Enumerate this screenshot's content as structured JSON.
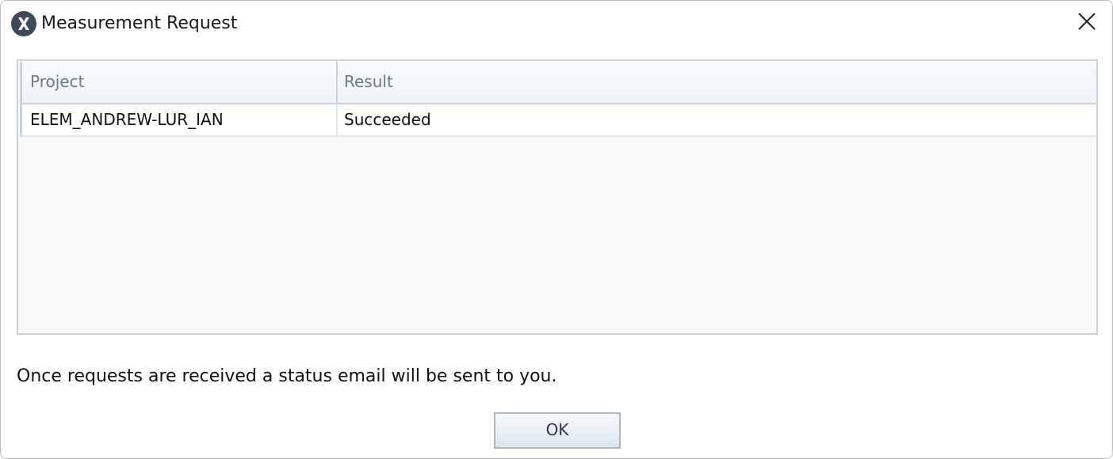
{
  "window": {
    "title": "Measurement Request",
    "app_icon": "x-circle-logo-icon",
    "close_icon": "close-icon"
  },
  "table": {
    "columns": [
      "Project",
      "Result"
    ],
    "rows": [
      [
        "ELEM_ANDREW-LUR_IAN",
        "Succeeded"
      ]
    ]
  },
  "message": "Once requests are received a status email will be sent to you.",
  "buttons": {
    "ok_label": "OK"
  },
  "colors": {
    "border": "#c9d2da",
    "header_text": "#6b7a88",
    "icon_dark": "#3d4a57"
  }
}
